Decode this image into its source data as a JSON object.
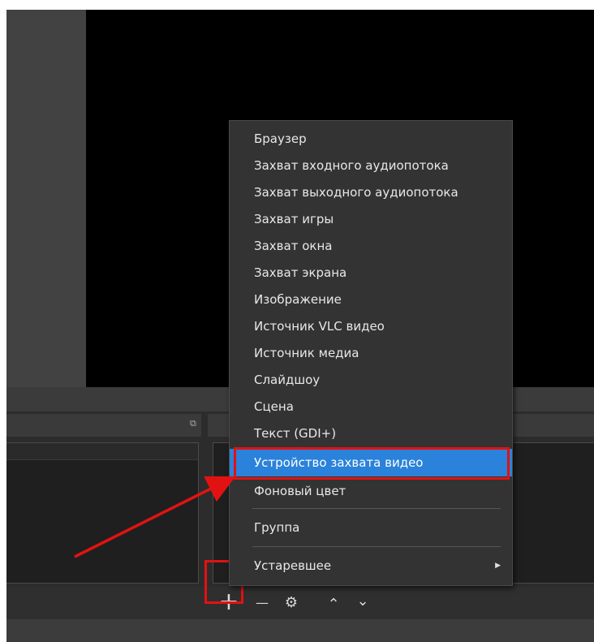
{
  "context_menu": {
    "items": [
      {
        "label": "Браузер"
      },
      {
        "label": "Захват входного аудиопотока"
      },
      {
        "label": "Захват выходного аудиопотока"
      },
      {
        "label": "Захват игры"
      },
      {
        "label": "Захват окна"
      },
      {
        "label": "Захват экрана"
      },
      {
        "label": "Изображение"
      },
      {
        "label": "Источник VLC видео"
      },
      {
        "label": "Источник медиа"
      },
      {
        "label": "Слайдшоу"
      },
      {
        "label": "Сцена"
      },
      {
        "label": "Текст (GDI+)"
      },
      {
        "label": "Устройство захвата видео",
        "selected": true
      },
      {
        "label": "Фоновый цвет"
      }
    ],
    "group_label": "Группа",
    "deprecated_label": "Устаревшее"
  },
  "toolbar": {
    "add_glyph": "+",
    "remove_glyph": "—",
    "settings_glyph": "⚙",
    "up_glyph": "⌃",
    "down_glyph": "⌄",
    "float_glyph": "⧉",
    "submenu_glyph": "▶"
  },
  "colors": {
    "highlight": "#2a82da",
    "annotation": "#e21212",
    "menu_bg": "#333333"
  }
}
